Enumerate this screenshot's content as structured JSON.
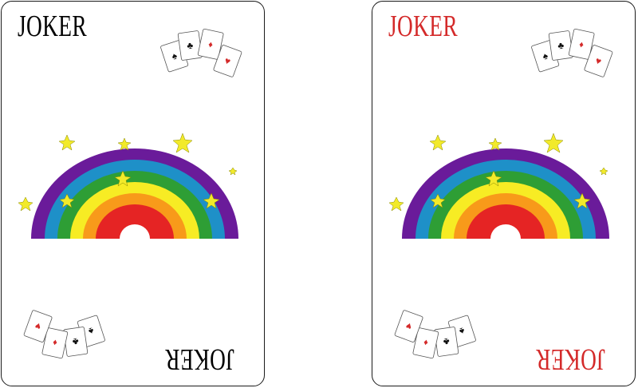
{
  "cards": [
    {
      "title": "JOKER",
      "title_color": "#111111",
      "suit_color_a": "#111111",
      "suit_color_b": "#d42a2a"
    },
    {
      "title": "JOKER",
      "title_color": "#d42a2a",
      "suit_color_a": "#111111",
      "suit_color_b": "#d42a2a"
    }
  ],
  "rainbow_colors": [
    "#6a1b9a",
    "#1e90c8",
    "#2e9e35",
    "#f7ec24",
    "#f89a1a",
    "#e52424"
  ],
  "star_color": "#f2ea2a"
}
